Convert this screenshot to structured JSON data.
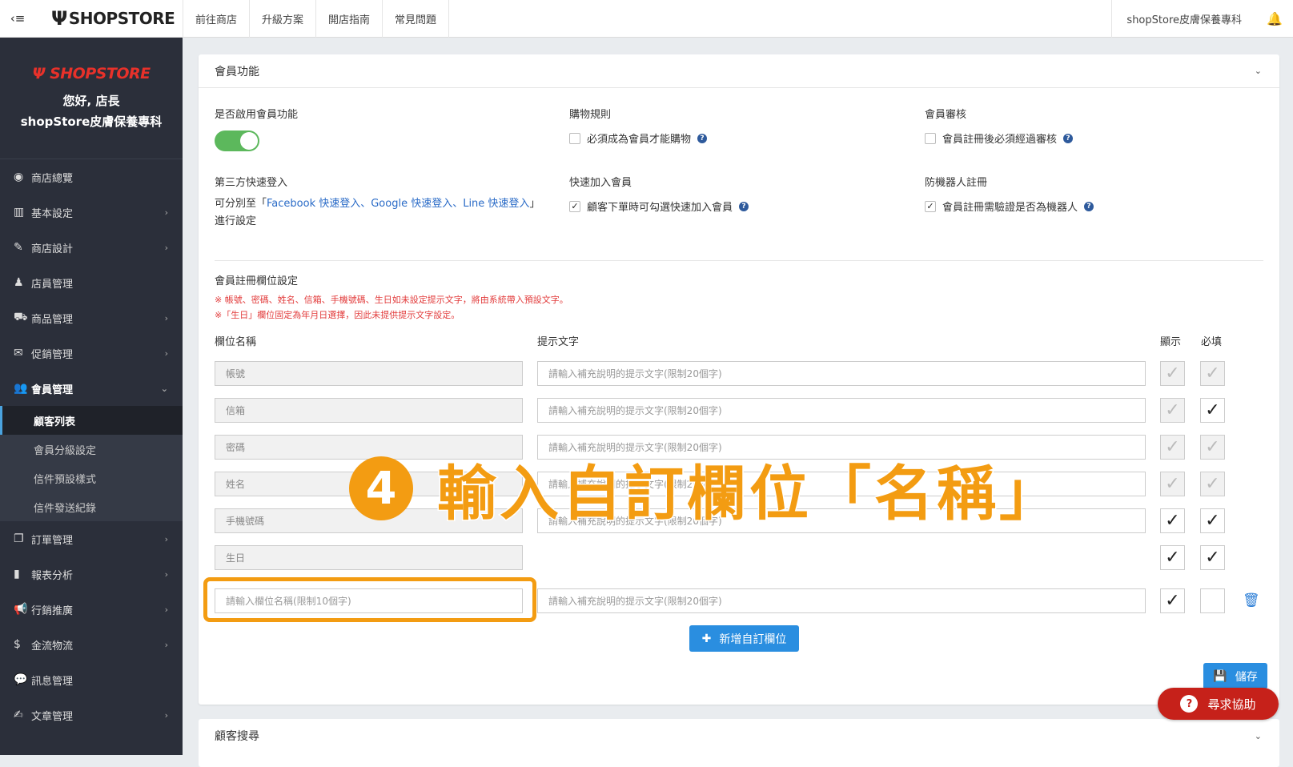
{
  "topbar": {
    "toggle_icon": "collapse-menu-icon",
    "logo_text": "SHOPSTORE",
    "nav": [
      "前往商店",
      "升級方案",
      "開店指南",
      "常見問題"
    ],
    "shop_name": "shopStore皮膚保養專科",
    "bell_icon": "bell-icon"
  },
  "sidebar": {
    "logo_text": "SHOPSTORE",
    "greeting": "您好, 店長",
    "store_name": "shopStore皮膚保養專科",
    "items": [
      {
        "label": "商店總覽",
        "icon": "dashboard-icon",
        "chevron": false
      },
      {
        "label": "基本設定",
        "icon": "bank-icon",
        "chevron": true
      },
      {
        "label": "商店設計",
        "icon": "magic-wand-icon",
        "chevron": true
      },
      {
        "label": "店員管理",
        "icon": "staff-icon",
        "chevron": false
      },
      {
        "label": "商品管理",
        "icon": "cart-icon",
        "chevron": true
      },
      {
        "label": "促銷管理",
        "icon": "gift-icon",
        "chevron": true
      },
      {
        "label": "會員管理",
        "icon": "users-icon",
        "chevron": true,
        "active": true
      }
    ],
    "subitems": [
      "顧客列表",
      "會員分級設定",
      "信件預設樣式",
      "信件發送紀錄"
    ],
    "items2": [
      {
        "label": "訂單管理",
        "icon": "order-icon",
        "chevron": true
      },
      {
        "label": "報表分析",
        "icon": "bar-chart-icon",
        "chevron": true
      },
      {
        "label": "行銷推廣",
        "icon": "megaphone-icon",
        "chevron": true
      },
      {
        "label": "金流物流",
        "icon": "dollar-icon",
        "chevron": true
      },
      {
        "label": "訊息管理",
        "icon": "chat-icon",
        "chevron": false
      },
      {
        "label": "文章管理",
        "icon": "edit-icon",
        "chevron": true
      }
    ]
  },
  "panel": {
    "title": "會員功能",
    "enable_label": "是否啟用會員功能",
    "shopping_rule_label": "購物規則",
    "shopping_rule_option": "必須成為會員才能購物",
    "review_label": "會員審核",
    "review_option": "會員註冊後必須經過審核",
    "third_party_label": "第三方快速登入",
    "third_party_pre": "可分別至「",
    "third_party_link": "Facebook 快速登入、Google 快速登入、Line 快速登入",
    "third_party_post": "」進行設定",
    "quick_join_label": "快速加入會員",
    "quick_join_option": "顧客下單時可勾選快速加入會員",
    "bot_label": "防機器人註冊",
    "bot_option": "會員註冊需驗證是否為機器人",
    "fields_section": "會員註冊欄位設定",
    "note1": "※ 帳號、密碼、姓名、信箱、手機號碼、生日如未設定提示文字，將由系統帶入預設文字。",
    "note2": "※「生日」欄位固定為年月日選擇，因此未提供提示文字設定。",
    "col_name": "欄位名稱",
    "col_hint": "提示文字",
    "col_show": "顯示",
    "col_required": "必填",
    "hint_placeholder": "請輸入補充說明的提示文字(限制20個字)",
    "rows": [
      {
        "name": "帳號",
        "hint": true,
        "show": "disabled",
        "required": "disabled"
      },
      {
        "name": "信箱",
        "hint": true,
        "show": "disabled",
        "required": "checked"
      },
      {
        "name": "密碼",
        "hint": true,
        "show": "disabled",
        "required": "disabled"
      },
      {
        "name": "姓名",
        "hint": true,
        "show": "disabled",
        "required": "disabled"
      },
      {
        "name": "手機號碼",
        "hint": true,
        "show": "checked",
        "required": "checked"
      },
      {
        "name": "生日",
        "hint": false,
        "show": "checked",
        "required": "checked"
      }
    ],
    "custom_name_placeholder": "請輸入欄位名稱(限制10個字)",
    "add_button": "新增自訂欄位",
    "save_button": "儲存"
  },
  "help_button": "尋求協助",
  "panel2_title": "顧客搜尋",
  "overlay": {
    "step": "4",
    "text": "輸入自訂欄位「名稱」",
    "color": "#f39c12"
  }
}
